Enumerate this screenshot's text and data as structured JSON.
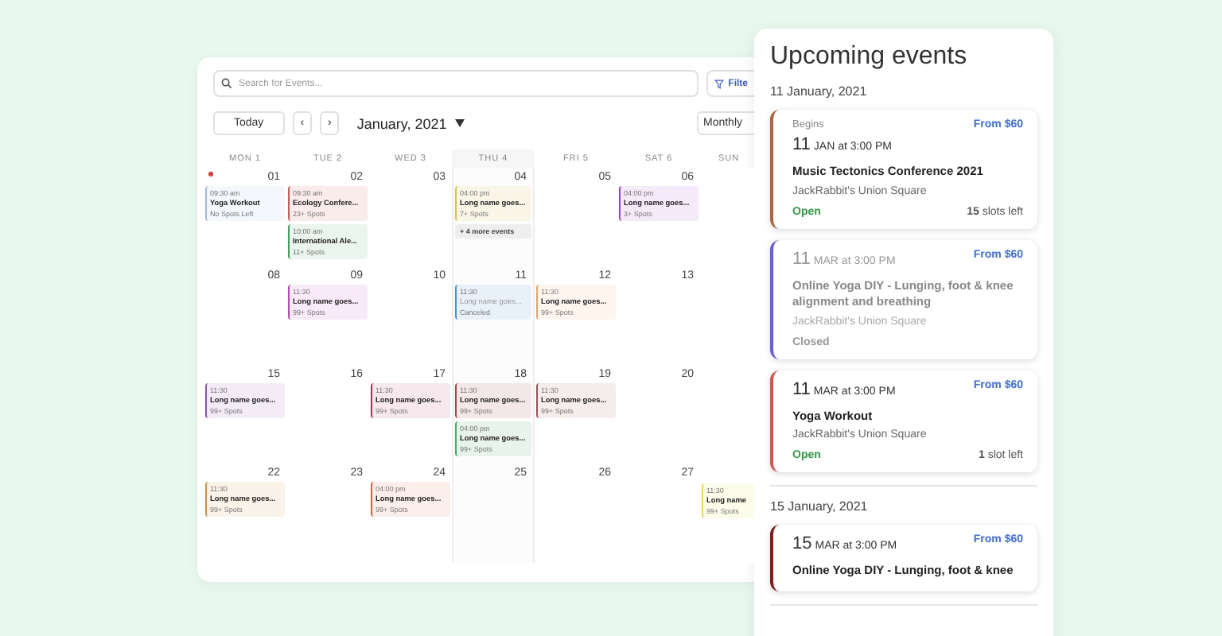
{
  "calendar": {
    "search": {
      "placeholder": "Search for Events..."
    },
    "filter_button": "Filte",
    "today_button": "Today",
    "prev_button": "‹",
    "next_button": "›",
    "month": "January, 2021",
    "view_select": "Monthly",
    "day_headers": [
      {
        "label": "MON 1",
        "highlighted": false
      },
      {
        "label": "TUE 2",
        "highlighted": false
      },
      {
        "label": "WED 3",
        "highlighted": false
      },
      {
        "label": "THU 4",
        "highlighted": true
      },
      {
        "label": "FRI 5",
        "highlighted": false
      },
      {
        "label": "SAT 6",
        "highlighted": false
      },
      {
        "label": "SUN",
        "highlighted": false
      }
    ],
    "weeks": [
      [
        {
          "number": "01",
          "today": true,
          "events": [
            {
              "time": "09:30 am",
              "title": "Yoga Workout",
              "spots": "No Spots Left",
              "color": "#9db8e8",
              "canceled": false
            }
          ]
        },
        {
          "number": "02",
          "events": [
            {
              "time": "09:30 am",
              "title": "Ecology Confere...",
              "spots": "23+ Spots",
              "color": "#d9534f",
              "canceled": false
            },
            {
              "time": "10:00 am",
              "title": "International Ale...",
              "spots": "11+ Spots",
              "color": "#3aa55a",
              "canceled": false
            }
          ]
        },
        {
          "number": "03"
        },
        {
          "number": "04",
          "events": [
            {
              "time": "04:00 pm",
              "title": "Long name goes...",
              "spots": "7+ Spots",
              "color": "#e0c040",
              "canceled": false
            }
          ],
          "more": "+ 4 more events"
        },
        {
          "number": "05"
        },
        {
          "number": "06",
          "events": [
            {
              "time": "04:00 pm",
              "title": "Long name goes...",
              "spots": "3+ Spots",
              "color": "#9b40d0",
              "canceled": false
            }
          ]
        }
      ],
      [
        {
          "number": "08"
        },
        {
          "number": "09",
          "events": [
            {
              "time": "11:30",
              "title": "Long name goes...",
              "spots": "99+ Spots",
              "color": "#c040c0",
              "canceled": false
            }
          ]
        },
        {
          "number": "10"
        },
        {
          "number": "11",
          "events": [
            {
              "time": "11:30",
              "title": "Long name goes...",
              "spots": "Canceled",
              "color": "#4a90e2",
              "canceled": true
            }
          ]
        },
        {
          "number": "12",
          "events": [
            {
              "time": "11:30",
              "title": "Long name goes...",
              "spots": "99+ Spots",
              "color": "#f0a060",
              "canceled": false
            }
          ]
        },
        {
          "number": "13"
        }
      ],
      [
        {
          "number": "15",
          "events": [
            {
              "time": "11:30",
              "title": "Long name goes...",
              "spots": "99+ Spots",
              "color": "#9050b0",
              "canceled": false
            }
          ]
        },
        {
          "number": "16"
        },
        {
          "number": "17",
          "events": [
            {
              "time": "11:30",
              "title": "Long name goes...",
              "spots": "99+ Spots",
              "color": "#b03050",
              "canceled": false
            }
          ]
        },
        {
          "number": "18",
          "events": [
            {
              "time": "11:30",
              "title": "Long name goes...",
              "spots": "99+ Spots",
              "color": "#b04040",
              "canceled": false
            },
            {
              "time": "04:00 pm",
              "title": "Long name goes...",
              "spots": "99+ Spots",
              "color": "#40b060",
              "canceled": false
            }
          ]
        },
        {
          "number": "19",
          "events": [
            {
              "time": "11:30",
              "title": "Long name goes...",
              "spots": "99+ Spots",
              "color": "#a05050",
              "canceled": false
            }
          ]
        },
        {
          "number": "20"
        }
      ],
      [
        {
          "number": "22",
          "events": [
            {
              "time": "11:30",
              "title": "Long name goes...",
              "spots": "99+ Spots",
              "color": "#d09040",
              "canceled": false
            }
          ]
        },
        {
          "number": "23"
        },
        {
          "number": "24",
          "events": [
            {
              "time": "04:00 pm",
              "title": "Long name goes...",
              "spots": "99+ Spots",
              "color": "#e06040",
              "canceled": false
            }
          ]
        },
        {
          "number": "25"
        },
        {
          "number": "26"
        },
        {
          "number": "27"
        },
        {
          "events": [
            {
              "time": "11:30",
              "title": "Long name",
              "spots": "99+ Spots",
              "color": "#e0e040",
              "canceled": false
            }
          ]
        }
      ]
    ]
  },
  "upcoming": {
    "title": "Upcoming events",
    "groups": [
      {
        "date": "11 January, 2021",
        "events": [
          {
            "begins": "Begins",
            "day": "11",
            "when": "JAN at 3:00 PM",
            "price": "From $60",
            "title": "Music Tectonics Conference 2021",
            "venue": "JackRabbit's Union Square",
            "status": {
              "label": "Open",
              "kind": "open"
            },
            "slots_count": "15",
            "slots_label": "slots left",
            "color": "#b0643c",
            "closed": false
          },
          {
            "day": "11",
            "when": "MAR at 3:00 PM",
            "price": "From $60",
            "title": "Online Yoga DIY - Lunging, foot & knee alignment and breathing",
            "venue": "JackRabbit's Union Square",
            "status": {
              "label": "Closed",
              "kind": "closed"
            },
            "color": "#6a5ce8",
            "closed": true
          },
          {
            "day": "11",
            "when": "MAR at 3:00 PM",
            "price": "From $60",
            "title": "Yoga Workout",
            "venue": "JackRabbit's Union Square",
            "status": {
              "label": "Open",
              "kind": "open"
            },
            "slots_count": "1",
            "slots_label": "slot left",
            "color": "#d9534f",
            "closed": false
          }
        ]
      },
      {
        "date": "15 January, 2021",
        "events": [
          {
            "day": "15",
            "when": "MAR at 3:00 PM",
            "price": "From $60",
            "title": "Online Yoga DIY - Lunging, foot & knee",
            "color": "#8b1a1a",
            "closed": false
          }
        ]
      }
    ]
  }
}
